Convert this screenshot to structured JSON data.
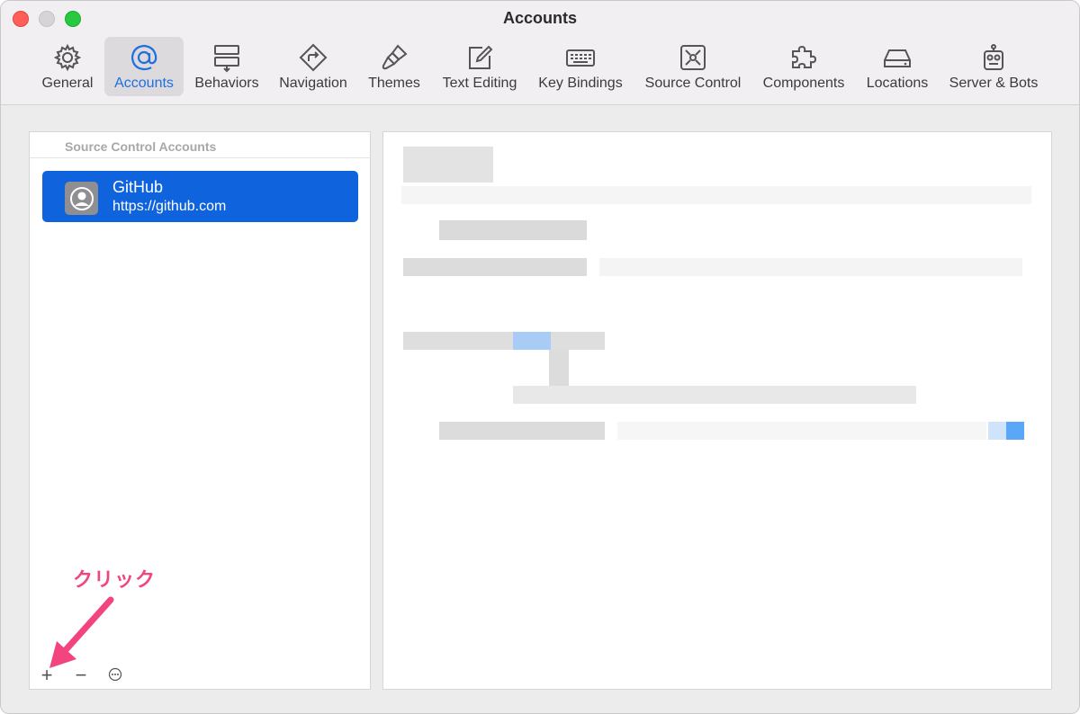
{
  "window": {
    "title": "Accounts"
  },
  "tabs": [
    {
      "label": "General",
      "icon": "gear-icon"
    },
    {
      "label": "Accounts",
      "icon": "at-sign-icon",
      "selected": true
    },
    {
      "label": "Behaviors",
      "icon": "behaviors-icon"
    },
    {
      "label": "Navigation",
      "icon": "navigation-icon"
    },
    {
      "label": "Themes",
      "icon": "paintbrush-icon"
    },
    {
      "label": "Text Editing",
      "icon": "text-editing-icon"
    },
    {
      "label": "Key Bindings",
      "icon": "keyboard-icon"
    },
    {
      "label": "Source Control",
      "icon": "source-control-icon"
    },
    {
      "label": "Components",
      "icon": "puzzle-icon"
    },
    {
      "label": "Locations",
      "icon": "disk-icon"
    },
    {
      "label": "Server & Bots",
      "icon": "robot-icon"
    }
  ],
  "sidebar": {
    "header": "Source Control Accounts",
    "accounts": [
      {
        "name": "GitHub",
        "url": "https://github.com",
        "selected": true
      }
    ],
    "buttons": {
      "add": "+",
      "remove": "−"
    }
  },
  "annotation": {
    "text": "クリック",
    "color": "#f2457f"
  },
  "colors": {
    "accent": "#0f64dd",
    "selected_tab_text": "#1f6fe0"
  }
}
